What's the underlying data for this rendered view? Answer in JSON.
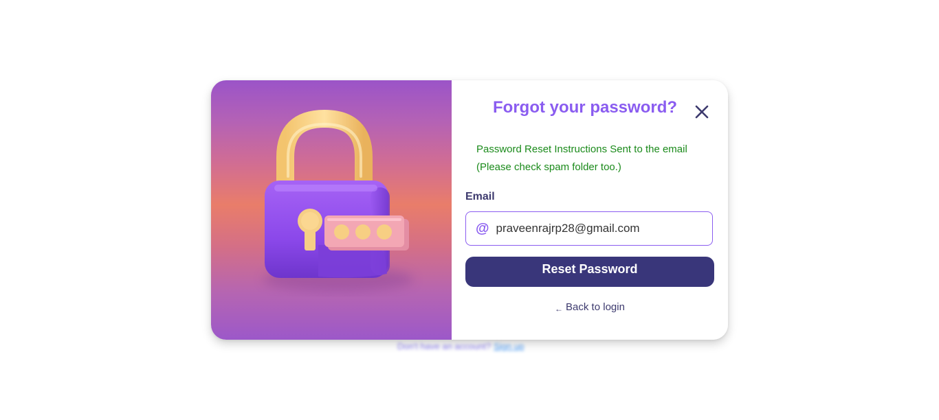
{
  "background": {
    "signup_text": "Don't have an account?",
    "signup_link": "Sign up"
  },
  "modal": {
    "title": "Forgot your password?",
    "close_icon": "close-icon",
    "success_message": {
      "line1": "Password Reset Instructions Sent to the email",
      "line2": "(Please check spam folder too.)"
    },
    "email": {
      "label": "Email",
      "icon": "at-icon",
      "value": "praveenrajrp28@gmail.com",
      "placeholder": ""
    },
    "reset_button_label": "Reset Password",
    "back_link": {
      "arrow": "←",
      "label": "Back to login"
    },
    "illustration": "padlock-illustration"
  },
  "colors": {
    "title": "#8a5cf0",
    "success": "#1a8a1a",
    "button": "#39367a",
    "text_dark": "#3d3a6e"
  }
}
